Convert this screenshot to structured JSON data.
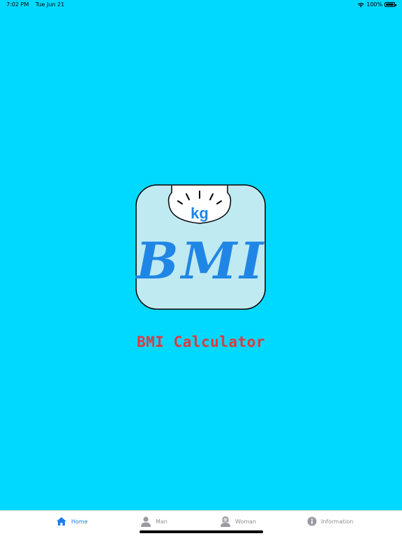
{
  "status_bar": {
    "time": "7:02 PM",
    "date": "Tue Jun 21",
    "battery": "100%",
    "icons": [
      "wifi-icon",
      "battery-icon"
    ]
  },
  "logo": {
    "unit_label": "kg",
    "text": "BMI",
    "colors": {
      "fill": "#bfeaf2",
      "outline": "#000000",
      "letters": "#1f86e6"
    }
  },
  "app": {
    "title": "BMI Calculator",
    "title_color": "#e0393f",
    "background": "#00d9ff"
  },
  "tab_bar": {
    "tabs": [
      {
        "label": "Home",
        "icon": "home-icon",
        "active": true
      },
      {
        "label": "Man",
        "icon": "man-icon",
        "active": false
      },
      {
        "label": "Woman",
        "icon": "woman-icon",
        "active": false
      },
      {
        "label": "Information",
        "icon": "info-icon",
        "active": false
      }
    ],
    "active_color": "#1a7cf0",
    "inactive_color": "#8e8e93"
  }
}
